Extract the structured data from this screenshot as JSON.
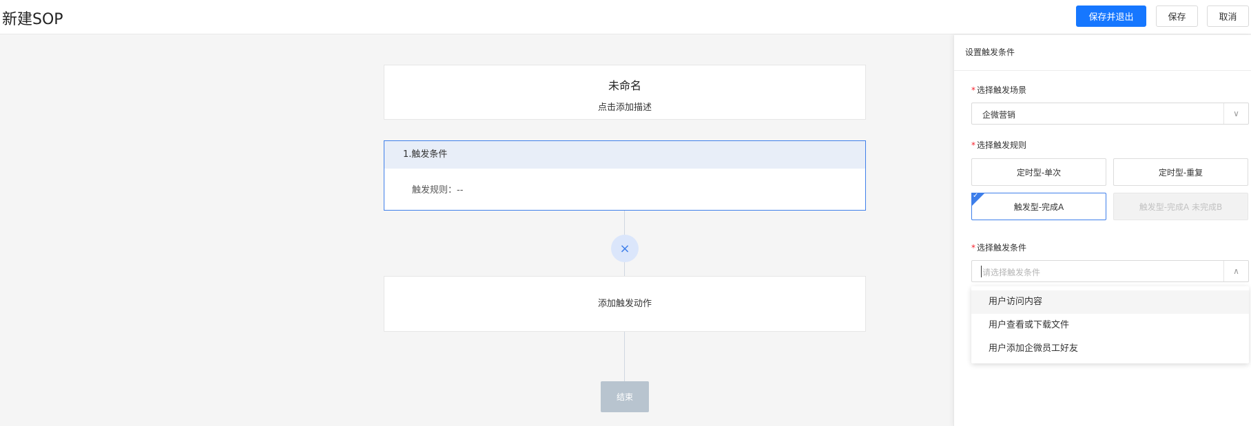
{
  "header": {
    "title": "新建SOP",
    "save_exit_label": "保存并退出",
    "save_label": "保存",
    "cancel_label": "取消"
  },
  "canvas": {
    "sop_name": "未命名",
    "sop_desc": "点击添加描述",
    "trigger_title": "1.触发条件",
    "trigger_rule_label": "触发规则：",
    "trigger_rule_value": "--",
    "add_action_label": "添加触发动作",
    "end_label": "结束",
    "close_icon": "×"
  },
  "panel": {
    "title": "设置触发条件",
    "scene": {
      "label": "选择触发场景",
      "required": "*",
      "value": "企微营销",
      "arrow": "∨"
    },
    "rule": {
      "label": "选择触发规则",
      "required": "*",
      "options": [
        "定时型-单次",
        "定时型-重复",
        "触发型-完成A",
        "触发型-完成A 未完成B"
      ],
      "selected_index": 2,
      "check": "✓"
    },
    "condition": {
      "label": "选择触发条件",
      "required": "*",
      "placeholder": "请选择触发条件",
      "arrow": "∧",
      "options": [
        "用户访问内容",
        "用户查看或下载文件",
        "用户添加企微员工好友"
      ]
    }
  },
  "colors": {
    "primary": "#1677ff",
    "accent_blue": "#3d7eea",
    "required_red": "#f5222d",
    "end_button": "#b8c4cf"
  }
}
